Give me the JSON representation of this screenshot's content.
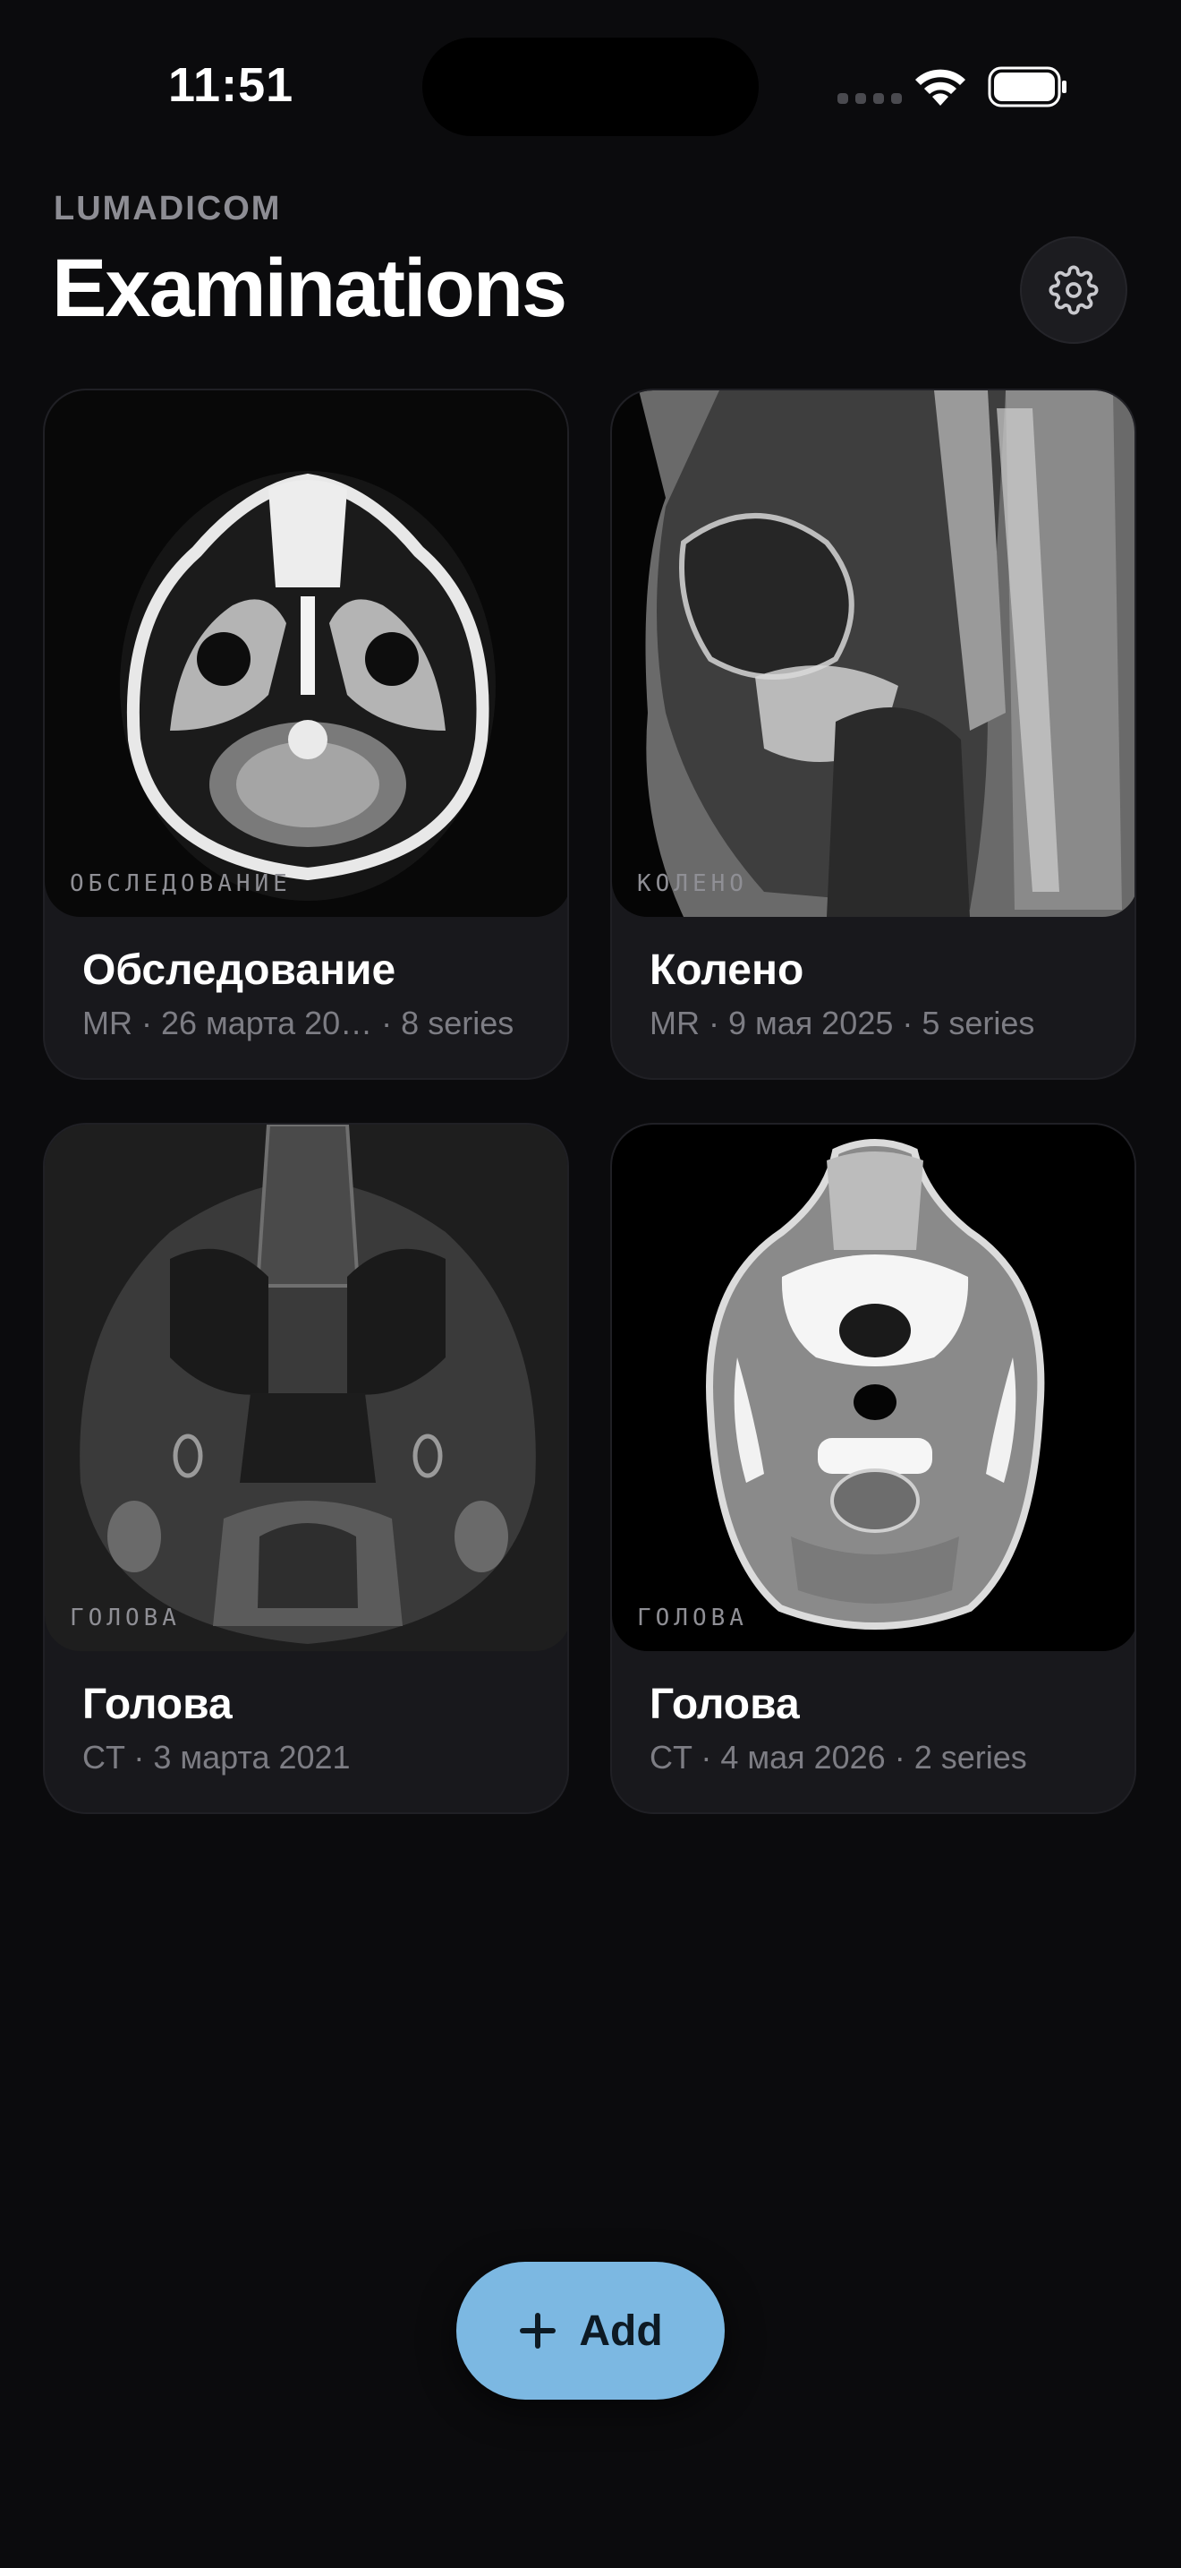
{
  "status_bar": {
    "time": "11:51"
  },
  "header": {
    "app_name": "LUMADICOM",
    "title": "Examinations"
  },
  "exams": [
    {
      "tag": "ОБСЛЕДОВАНИЕ",
      "title": "Обследование",
      "meta": "MR · 26 марта 20…  · 8 series",
      "image": "brain-mri-axial"
    },
    {
      "tag": "КОЛЕНО",
      "title": "Колено",
      "meta": "MR · 9 мая 2025  · 5 series",
      "image": "knee-mri-sagittal"
    },
    {
      "tag": "ГОЛОВА",
      "title": "Голова",
      "meta": "CT · 3 марта 2021",
      "image": "head-ct-bone"
    },
    {
      "tag": "ГОЛОВА",
      "title": "Голова",
      "meta": "CT · 4 мая 2026  · 2 series",
      "image": "head-ct-soft"
    }
  ],
  "add_button": {
    "label": "Add",
    "color": "#7cb8e2"
  },
  "icons": {
    "settings": "gear-icon",
    "add": "plus-icon",
    "wifi": "wifi-icon",
    "battery": "battery-icon"
  }
}
